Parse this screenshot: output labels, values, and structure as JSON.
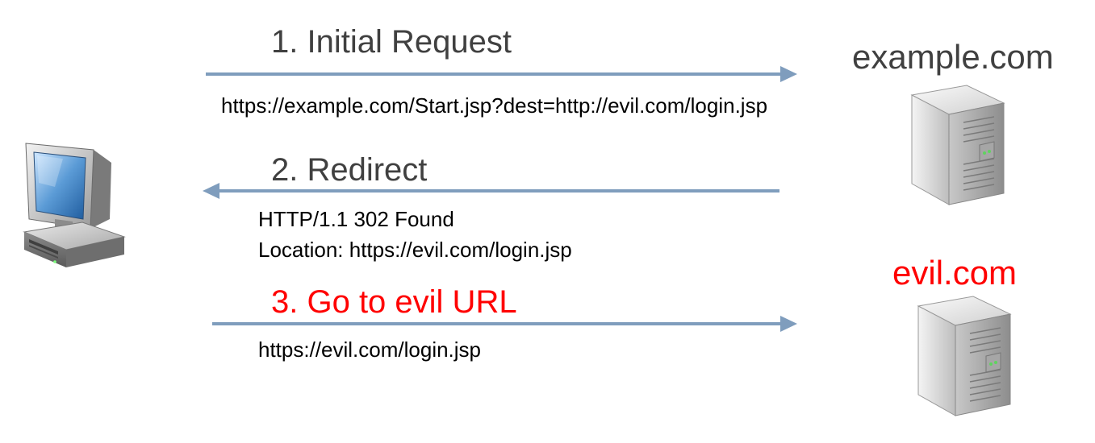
{
  "steps": [
    {
      "label": "1. Initial Request",
      "detail_lines": [
        "https://example.com/Start.jsp?dest=http://evil.com/login.jsp"
      ],
      "direction": "client-to-server",
      "color": "#404040"
    },
    {
      "label": "2. Redirect",
      "detail_lines": [
        "HTTP/1.1 302 Found",
        "Location: https://evil.com/login.jsp"
      ],
      "direction": "server-to-client",
      "color": "#404040"
    },
    {
      "label": "3. Go to evil URL",
      "detail_lines": [
        "https://evil.com/login.jsp"
      ],
      "direction": "client-to-server",
      "color": "#ff0000"
    }
  ],
  "servers": [
    {
      "label": "example.com",
      "icon": "server-tower-icon",
      "color": "#404040"
    },
    {
      "label": "evil.com",
      "icon": "server-tower-icon",
      "color": "#ff0000"
    }
  ],
  "client": {
    "icon": "desktop-computer-icon"
  },
  "colors": {
    "arrow": "#7f9dbd",
    "label_default": "#404040",
    "label_evil": "#ff0000",
    "detail_text": "#000000"
  }
}
